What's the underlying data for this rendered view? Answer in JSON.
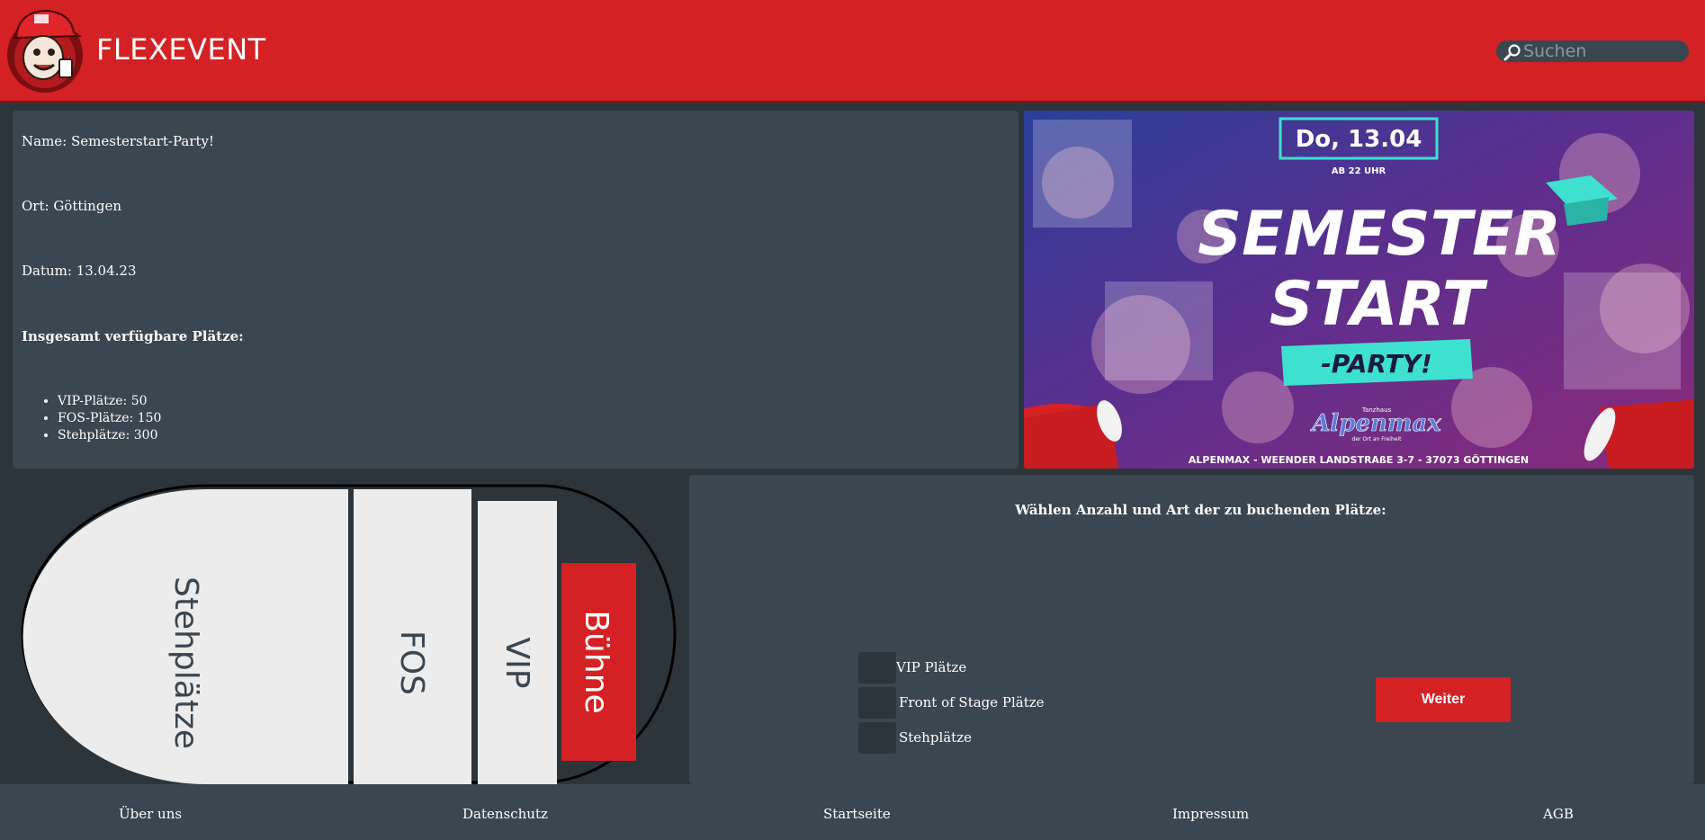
{
  "header": {
    "brand": "FLEXEVENT",
    "search_placeholder": "Suchen"
  },
  "event": {
    "name_line": "Name: Semesterstart-Party!",
    "location_line": "Ort: Göttingen",
    "date_line": "Datum: 13.04.23",
    "available_heading": "Insgesamt verfügbare Plätze:",
    "seats": [
      "VIP-Plätze: 50",
      "FOS-Plätze: 150",
      "Stehplätze: 300"
    ]
  },
  "poster": {
    "date": "Do, 13.04",
    "time": "AB 22 UHR",
    "title_line1": "SEMESTER",
    "title_line2": "START",
    "subtitle": "-PARTY!",
    "venue_small": "Tanzhaus",
    "venue_logo": "Alpenmax",
    "venue_tag": "der Ort an Freiheit",
    "address": "ALPENMAX - WEENDER LANDSTRAßE 3-7 - 37073 GÖTTINGEN"
  },
  "venue_map": {
    "sections": {
      "standing": "Stehplätze",
      "fos": "FOS",
      "vip": "VIP",
      "stage": "Bühne"
    }
  },
  "booking": {
    "title": "Wählen Anzahl und Art der zu buchenden Plätze:",
    "options": [
      "VIP Plätze",
      "Front of Stage Plätze",
      "Stehplätze"
    ],
    "continue_label": "Weiter"
  },
  "footer": {
    "links": [
      "Über uns",
      "Datenschutz",
      "Startseite",
      "Impressum",
      "AGB"
    ]
  },
  "colors": {
    "brand_red": "#d42124",
    "panel": "#3a4650",
    "background": "#2d353c",
    "poster_accent": "#3ee0cf"
  }
}
